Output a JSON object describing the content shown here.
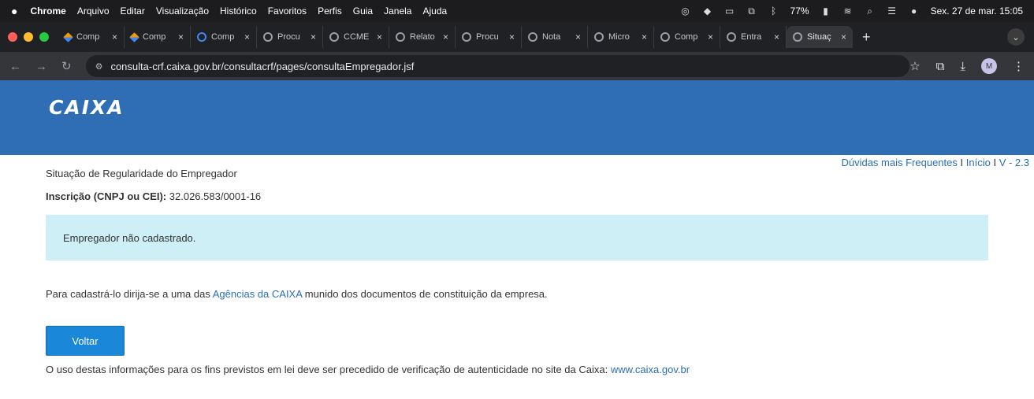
{
  "os_menu": {
    "app": "Chrome",
    "items": [
      "Arquivo",
      "Editar",
      "Visualização",
      "Histórico",
      "Favoritos",
      "Perfis",
      "Guia",
      "Janela",
      "Ajuda"
    ],
    "battery": "77%",
    "datetime": "Sex. 27 de mar. 15:05"
  },
  "tabs": [
    {
      "title": "Comp",
      "icon": "diamond"
    },
    {
      "title": "Comp",
      "icon": "diamond"
    },
    {
      "title": "Comp",
      "icon": "prime"
    },
    {
      "title": "Procu",
      "icon": "globe"
    },
    {
      "title": "CCME",
      "icon": "globe"
    },
    {
      "title": "Relato",
      "icon": "globe"
    },
    {
      "title": "Procu",
      "icon": "globe"
    },
    {
      "title": "Nota",
      "icon": "globe"
    },
    {
      "title": "Micro",
      "icon": "globe"
    },
    {
      "title": "Comp",
      "icon": "globe"
    },
    {
      "title": "Entra",
      "icon": "globe"
    },
    {
      "title": "Situaç",
      "icon": "globe",
      "active": true
    }
  ],
  "address_bar": {
    "url": "consulta-crf.caixa.gov.br/consultacrf/pages/consultaEmpregador.jsf",
    "profile_initial": "M"
  },
  "page": {
    "logo": "CAIXA",
    "toplinks": {
      "faq": "Dúvidas mais Frequentes",
      "sep": "I",
      "inicio": "Início",
      "version": "V - 2.3"
    },
    "title": "Situação de Regularidade do Empregador",
    "inscricao_label": "Inscrição (CNPJ ou CEI):",
    "inscricao_value": "32.026.583/0001-16",
    "alert": "Empregador não cadastrado.",
    "para_before": "Para cadastrá-lo dirija-se a uma das ",
    "para_link": "Agências da CAIXA",
    "para_after": " munido dos documentos de constituição da empresa.",
    "button": "Voltar",
    "footer_text": "O uso destas informações para os fins previstos em lei deve ser precedido de verificação de autenticidade no site da Caixa: ",
    "footer_link": "www.caixa.gov.br"
  },
  "colors": {
    "banner": "#2f6db5",
    "alert_bg": "#cdeff5",
    "link": "#2a6fb5",
    "button": "#1a87d8"
  }
}
